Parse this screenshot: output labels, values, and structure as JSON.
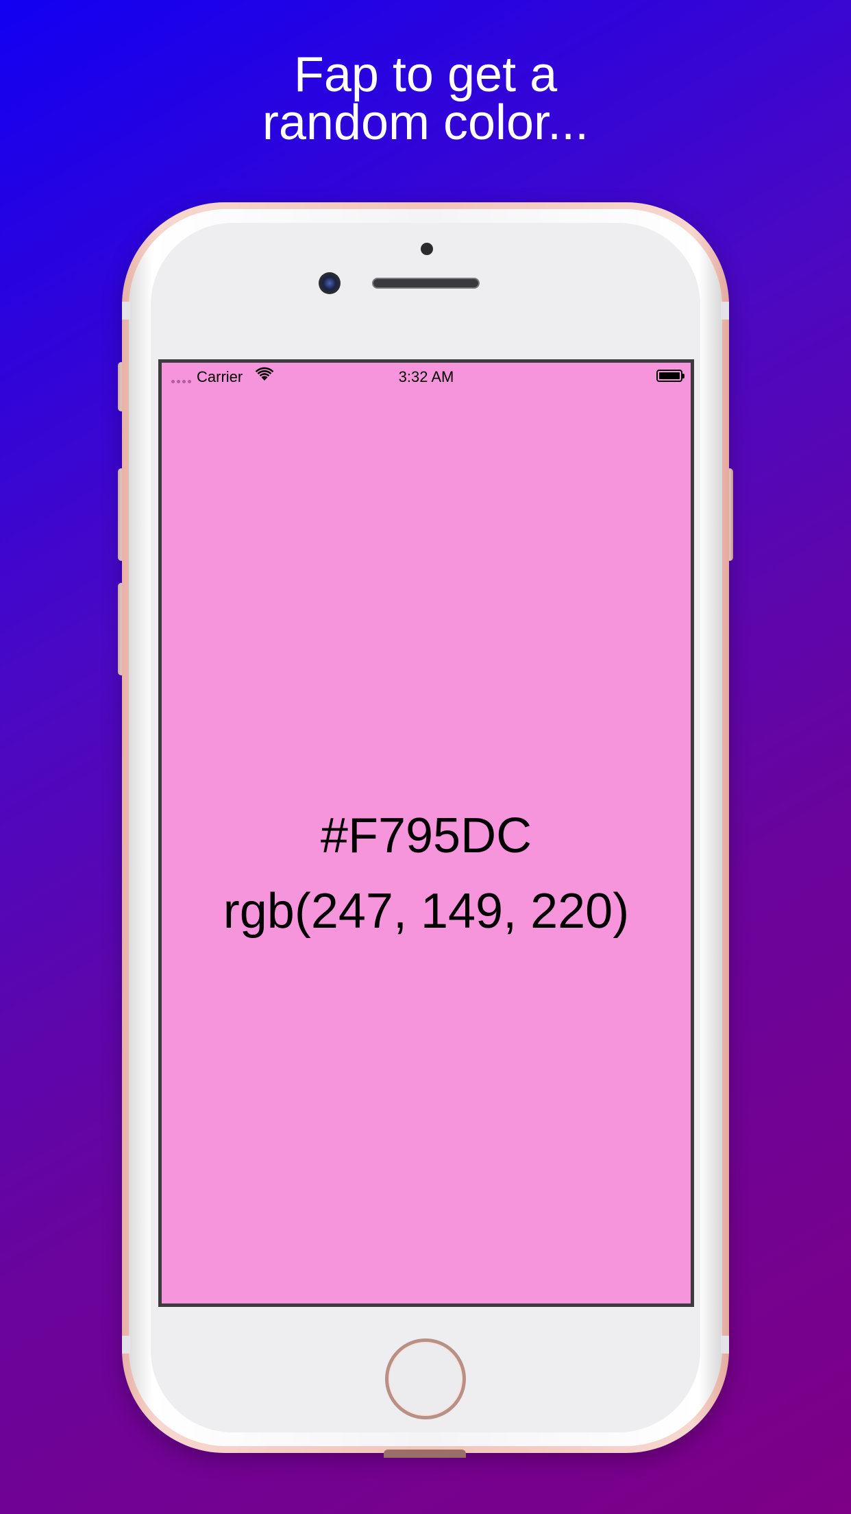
{
  "headline": {
    "line1": "Fap to get a",
    "line2": "random color..."
  },
  "status_bar": {
    "carrier": "Carrier",
    "time": "3:32 AM",
    "wifi_icon": "wifi-icon",
    "battery_icon": "battery-icon"
  },
  "screen": {
    "background_color": "#F795DC",
    "hex_label": "#F795DC",
    "rgb_label": "rgb(247, 149, 220)"
  },
  "colors": {
    "gradient_start": "#1200f2",
    "gradient_end": "#7d0086",
    "phone_frame": "#f2c4ba"
  }
}
